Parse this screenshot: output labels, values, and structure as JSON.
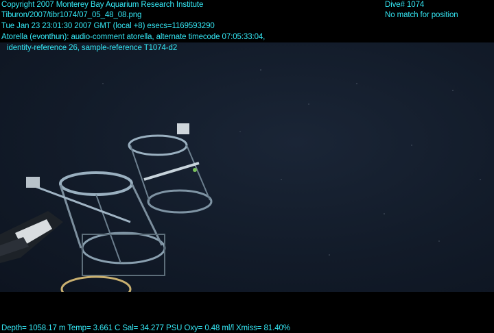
{
  "overlay": {
    "copyright": "Copyright 2007 Monterey Bay Aquarium Research Institute",
    "filepath": "Tiburon/2007/tibr1074/07_05_48_08.png",
    "timestamp": "Tue Jan 23 23:01:30 2007 GMT (local +8)  esecs=1169593290",
    "comment_line1": "Atorella (evonthun): audio-comment atorella, alternate timecode 07:05:33:04,",
    "comment_line2": "identity-reference 26, sample-reference T1074-d2",
    "dive": "Dive# 1074",
    "position": "No match for position",
    "telemetry": "Depth= 1058.17 m  Temp= 3.661 C  Sal= 34.277 PSU  Oxy= 0.48 ml/l  Xmiss= 81.40%"
  },
  "colors": {
    "overlay_text": "#35e8f5",
    "water": "#121b29",
    "letterbox": "#000000"
  }
}
